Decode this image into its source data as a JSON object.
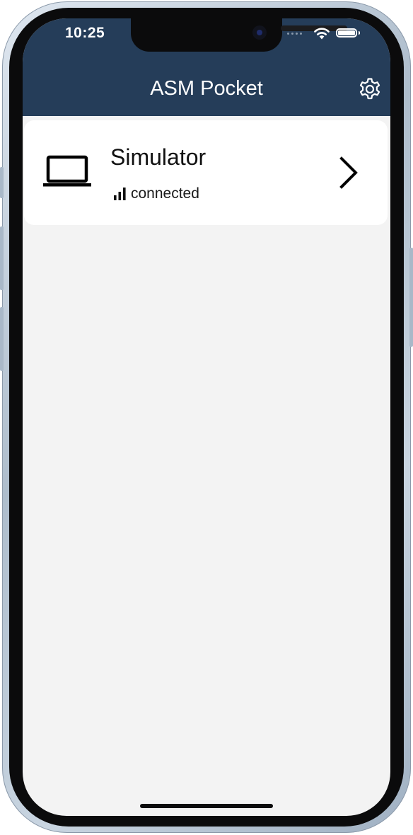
{
  "status_bar": {
    "time": "10:25",
    "wifi_icon": "wifi-icon",
    "battery_icon": "battery-full-icon"
  },
  "nav": {
    "title": "ASM Pocket",
    "settings_icon": "gear-icon"
  },
  "devices": [
    {
      "icon": "laptop-icon",
      "name": "Simulator",
      "status": "connected",
      "status_icon": "signal-bars-icon",
      "action_icon": "chevron-right-icon"
    }
  ],
  "colors": {
    "header": "#253d59",
    "background": "#f3f3f3",
    "card": "#ffffff",
    "text": "#111111"
  }
}
